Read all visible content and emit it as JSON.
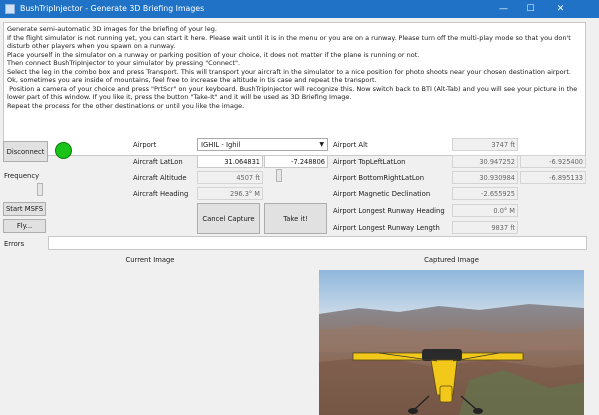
{
  "window": {
    "title": "BushTripInjector - Generate 3D Briefing Images",
    "minimize_icon": "minimize-icon",
    "maximize_icon": "maximize-icon",
    "close_icon": "close-icon"
  },
  "description": "Generate semi-automatic 3D images for the briefing of your leg.\nIf the flight simulator is not running yet, you can start it here. Please wait until it is in the menu or you are on a runway. Please turn off the multi-play mode so that you don't disturb other players when you spawn on a runway.\nPlace yourself in the simulator on a runway or parking position of your choice, it does not matter if the plane is running or not.\nThen connect BushTripInjector to your simulator by pressing \"Connect\".\nSelect the leg in the combo box and press Transport. This will transport your aircraft in the simulator to a nice position for photo shoots near your chosen destination airport. Ok, sometimes you are inside of mountains, feel free to increase the altitude in tis case and repeat the transport.\n Position a camera of your choice and press \"PrtScr\" on your keyboard. BushTripInjector will recognize this. Now switch back to BTI (Alt-Tab) and you will see your picture in the lower part of this window. If you like it, press the button \"Take-It\" and it will be used as 3D Briefing Image.\nRepeat the process for the other destinations or until you like the image.",
  "left_panel": {
    "connect_label": "Disconnect",
    "frequency_label": "Frequency",
    "start_msfs_label": "Start MSFS",
    "fly_label": "Fly...",
    "status_color": "#19c419"
  },
  "form": {
    "airport_label": "Airport",
    "airport_value": "IGHIL - Ighil",
    "latlon_label": "Aircraft LatLon",
    "lat_value": "31.064831",
    "lon_value": "-7.248806",
    "altitude_label": "Aircraft Altitude",
    "altitude_value": "4507 ft",
    "heading_label": "Aircraft Heading",
    "heading_value": "296.3° M",
    "cancel_capture_label": "Cancel Capture",
    "take_it_label": "Take it!"
  },
  "airport_info": {
    "alt_label": "Airport Alt",
    "alt_value": "3747 ft",
    "top_left_label": "Airport TopLeftLatLon",
    "top_left_lat": "30.947252",
    "top_left_lon": "-6.925400",
    "bottom_right_label": "Airport BottomRightLatLon",
    "bottom_right_lat": "30.930984",
    "bottom_right_lon": "-6.895133",
    "mag_decl_label": "Airport Magnetic Declination",
    "mag_decl_value": "-2.655925",
    "longest_heading_label": "Airport Longest Runway Heading",
    "longest_heading_value": "0.0° M",
    "longest_length_label": "Airport Longest Runway Length",
    "longest_length_value": "9837 ft"
  },
  "errors": {
    "label": "Errors",
    "value": ""
  },
  "images": {
    "current_label": "Current Image",
    "captured_label": "Captured Image"
  }
}
